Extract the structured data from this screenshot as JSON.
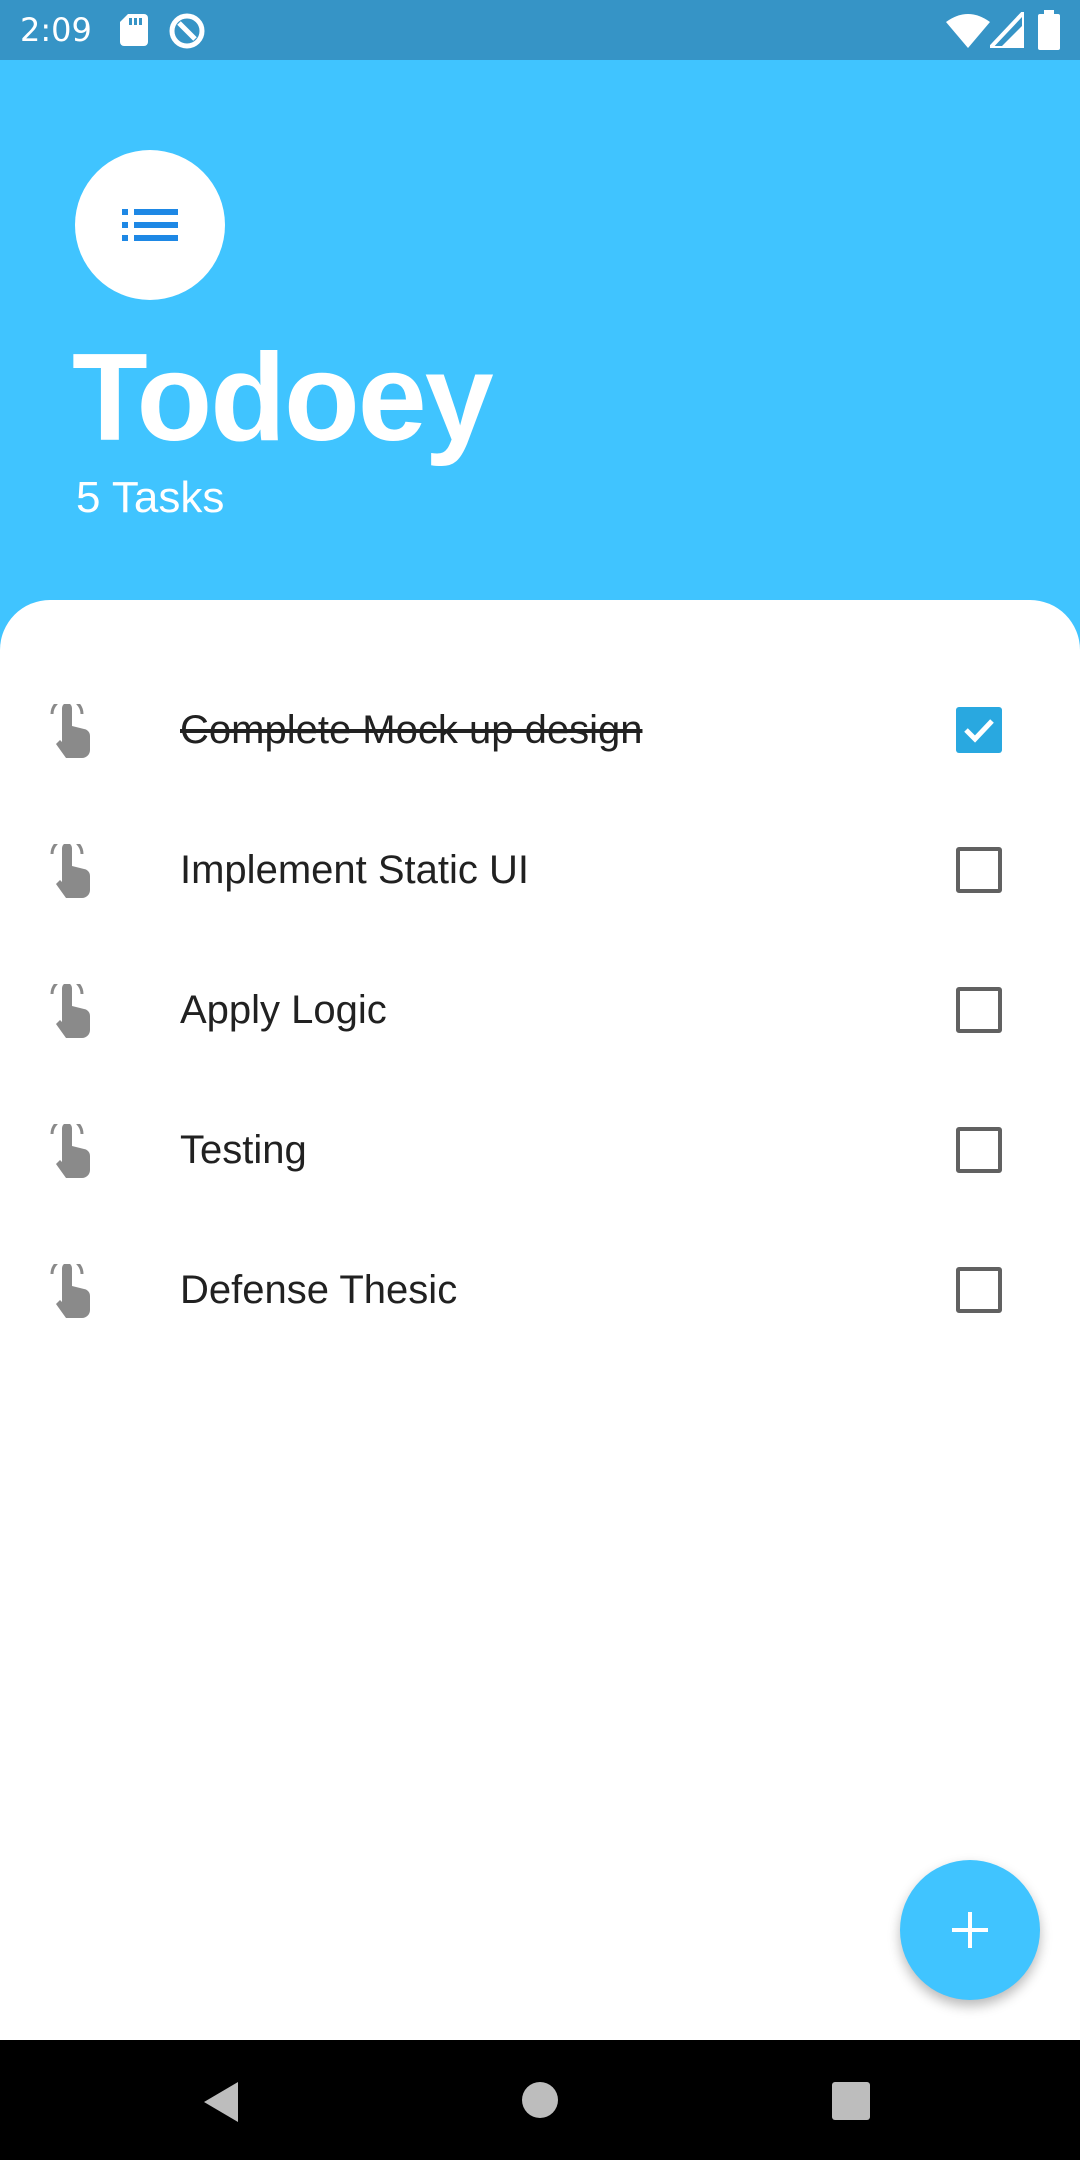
{
  "status_bar": {
    "time": "2:09",
    "icons": [
      "sd-card-icon",
      "sync-icon",
      "wifi-icon",
      "cell-signal-icon",
      "battery-icon"
    ]
  },
  "header": {
    "logo_icon": "list-icon",
    "title": "Todoey",
    "task_count": "5 Tasks"
  },
  "tasks": [
    {
      "title": "Complete Mock up design",
      "done": true
    },
    {
      "title": "Implement Static UI",
      "done": false
    },
    {
      "title": "Apply Logic",
      "done": false
    },
    {
      "title": "Testing",
      "done": false
    },
    {
      "title": "Defense Thesic",
      "done": false
    }
  ],
  "fab": {
    "icon": "plus-icon"
  },
  "nav_bar": {
    "icons": [
      "back-icon",
      "home-icon",
      "recents-icon"
    ]
  },
  "colors": {
    "accent": "#40C4FF",
    "status_bar": "#3694C6",
    "checkbox_checked": "#29A8E0",
    "logo_icon": "#1E88E5",
    "text": "#212121"
  }
}
